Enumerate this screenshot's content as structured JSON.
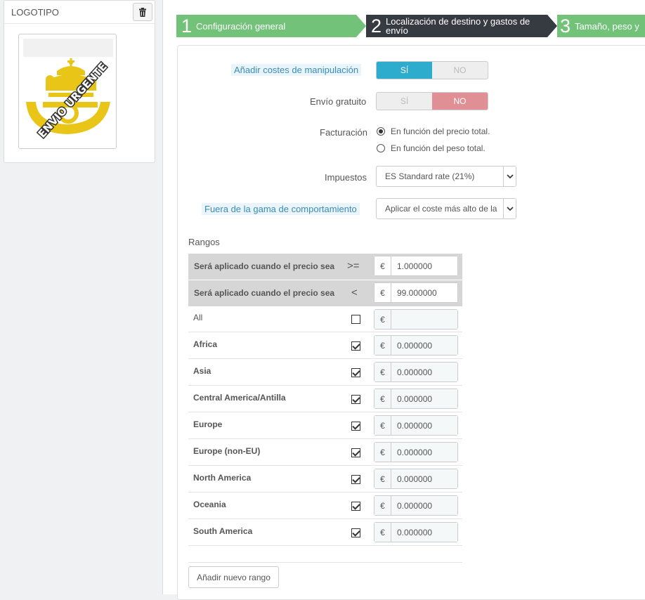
{
  "logo_panel": {
    "title": "LOGOTIPO",
    "delete_icon": "trash-icon",
    "logo_text": "ENVIO URGENTE",
    "logo_color": "#e8c516"
  },
  "steps": [
    {
      "number": "1",
      "label": "Configuración general",
      "state": "done",
      "color": "#72c279"
    },
    {
      "number": "2",
      "label": "Localización de destino y gastos de envío",
      "state": "active",
      "color": "#363a41"
    },
    {
      "number": "3",
      "label": "Tamaño, peso y",
      "state": "pending",
      "color": "#72c279"
    }
  ],
  "form": {
    "handling": {
      "label": "Añadir costes de manipulación",
      "yes": "SÍ",
      "no": "NO",
      "value": "yes"
    },
    "free_shipping": {
      "label": "Envío gratuito",
      "yes": "SÍ",
      "no": "NO",
      "value": "no"
    },
    "billing": {
      "label": "Facturación",
      "options": [
        "En función del precio total.",
        "En función del peso total."
      ],
      "selected": "En función del precio total."
    },
    "tax": {
      "label": "Impuestos",
      "value": "ES Standard rate (21%)"
    },
    "out_of_range": {
      "label": "Fuera de la gama de comportamiento",
      "value": "Aplicar el coste más alto de la"
    }
  },
  "ranges": {
    "title": "Rangos",
    "currency": "€",
    "from": {
      "label": "Será aplicado cuando el precio sea",
      "operator": ">=",
      "value": "1.000000"
    },
    "to": {
      "label": "Será aplicado cuando el precio sea",
      "operator": "<",
      "value": "99.000000"
    },
    "all_label": "All",
    "zones": [
      {
        "name": "Africa",
        "checked": true,
        "value": "0.000000"
      },
      {
        "name": "Asia",
        "checked": true,
        "value": "0.000000"
      },
      {
        "name": "Central America/Antilla",
        "checked": true,
        "value": "0.000000"
      },
      {
        "name": "Europe",
        "checked": true,
        "value": "0.000000"
      },
      {
        "name": "Europe (non-EU)",
        "checked": true,
        "value": "0.000000"
      },
      {
        "name": "North America",
        "checked": true,
        "value": "0.000000"
      },
      {
        "name": "Oceania",
        "checked": true,
        "value": "0.000000"
      },
      {
        "name": "South America",
        "checked": true,
        "value": "0.000000"
      }
    ],
    "add_button": "Añadir nuevo rango"
  }
}
